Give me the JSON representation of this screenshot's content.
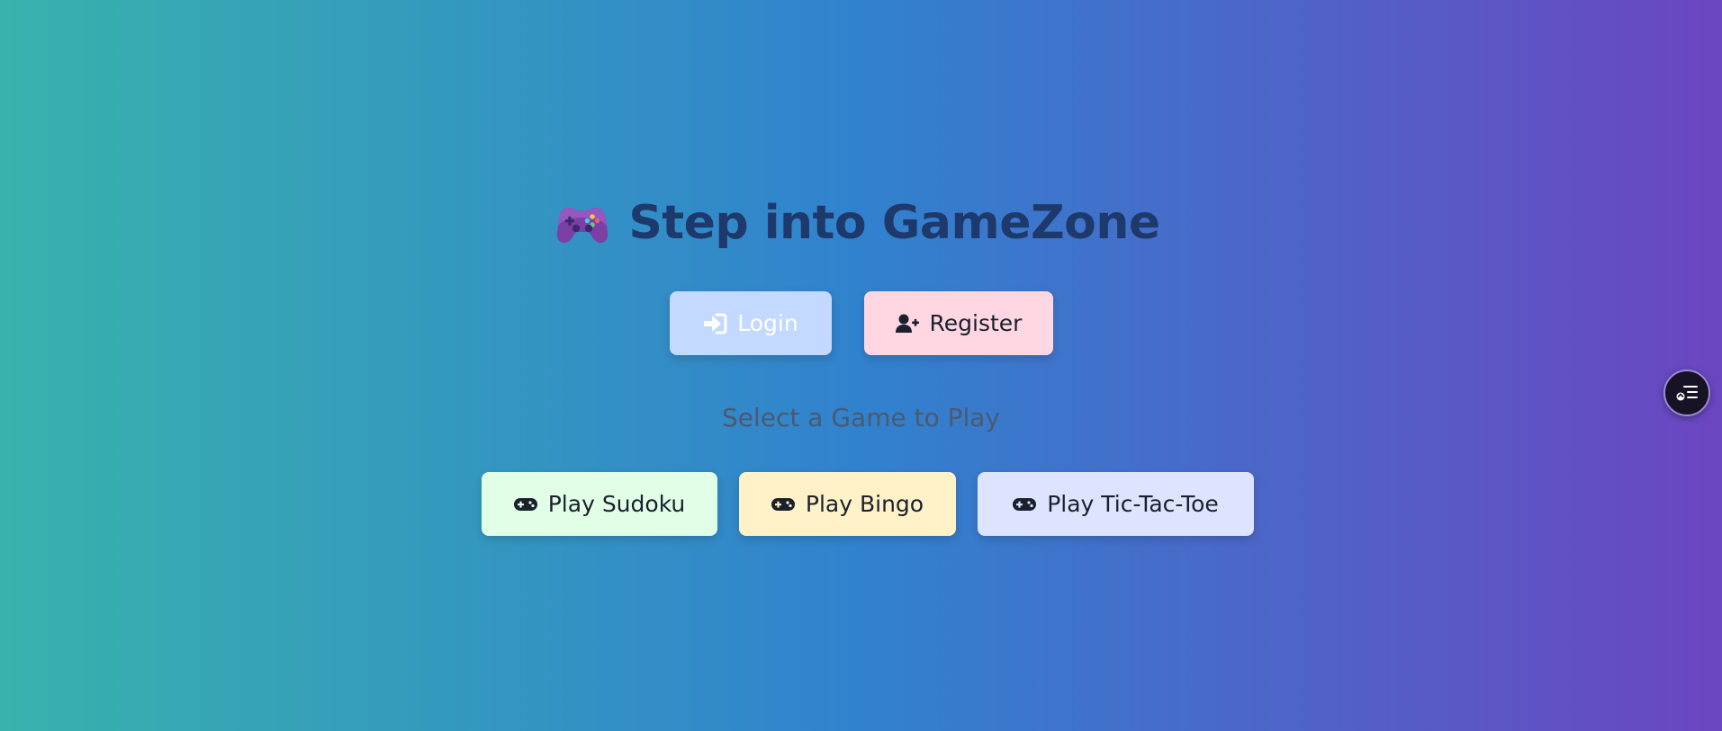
{
  "header": {
    "title": "Step into GameZone",
    "title_icon": "gamepad-emoji-icon"
  },
  "auth": {
    "login_label": "Login",
    "login_icon": "sign-in-icon",
    "register_label": "Register",
    "register_icon": "user-plus-icon"
  },
  "games": {
    "subtitle": "Select a Game to Play",
    "items": [
      {
        "label": "Play Sudoku",
        "icon": "gamepad-icon",
        "color": "#e0ffe6"
      },
      {
        "label": "Play Bingo",
        "icon": "gamepad-icon",
        "color": "#fff2c9"
      },
      {
        "label": "Play Tic-Tac-Toe",
        "icon": "gamepad-icon",
        "color": "#dde4ff"
      }
    ]
  },
  "floating_action": {
    "icon": "menu-list-icon"
  },
  "colors": {
    "gradient_start": "#38b2ac",
    "gradient_mid": "#3182ce",
    "gradient_end": "#6b46c1",
    "title": "#1e3a6d",
    "login_bg": "#c3d9ff",
    "register_bg": "#fed7e2"
  }
}
